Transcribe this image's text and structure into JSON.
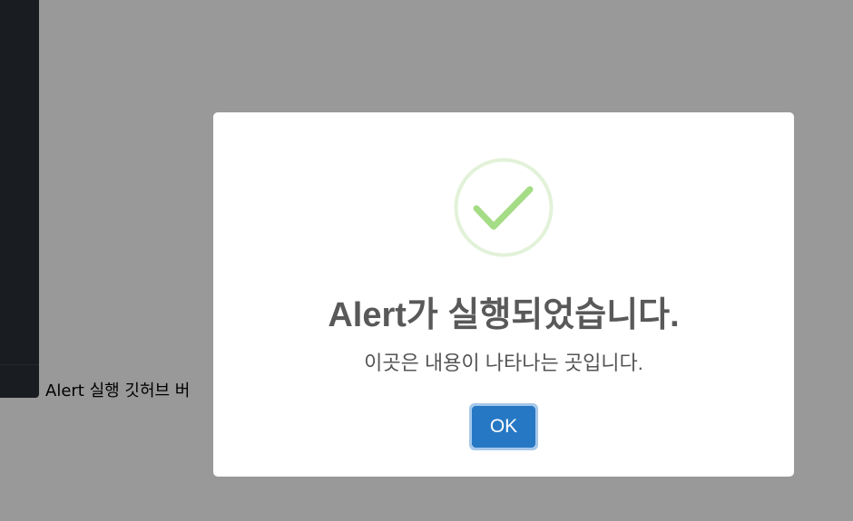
{
  "page": {
    "button_label": "Alert 실행 깃허브 버"
  },
  "modal": {
    "icon": "success-check-icon",
    "title": "Alert가 실행되었습니다.",
    "text": "이곳은 내용이 나타나는 곳입니다.",
    "confirm_label": "OK"
  },
  "colors": {
    "backdrop": "#999999",
    "dark_panel": "#111214",
    "check_ring": "#e2f2d9",
    "check_mark": "#a5dc86",
    "title_text": "#595959",
    "confirm_button": "#2778c4"
  }
}
